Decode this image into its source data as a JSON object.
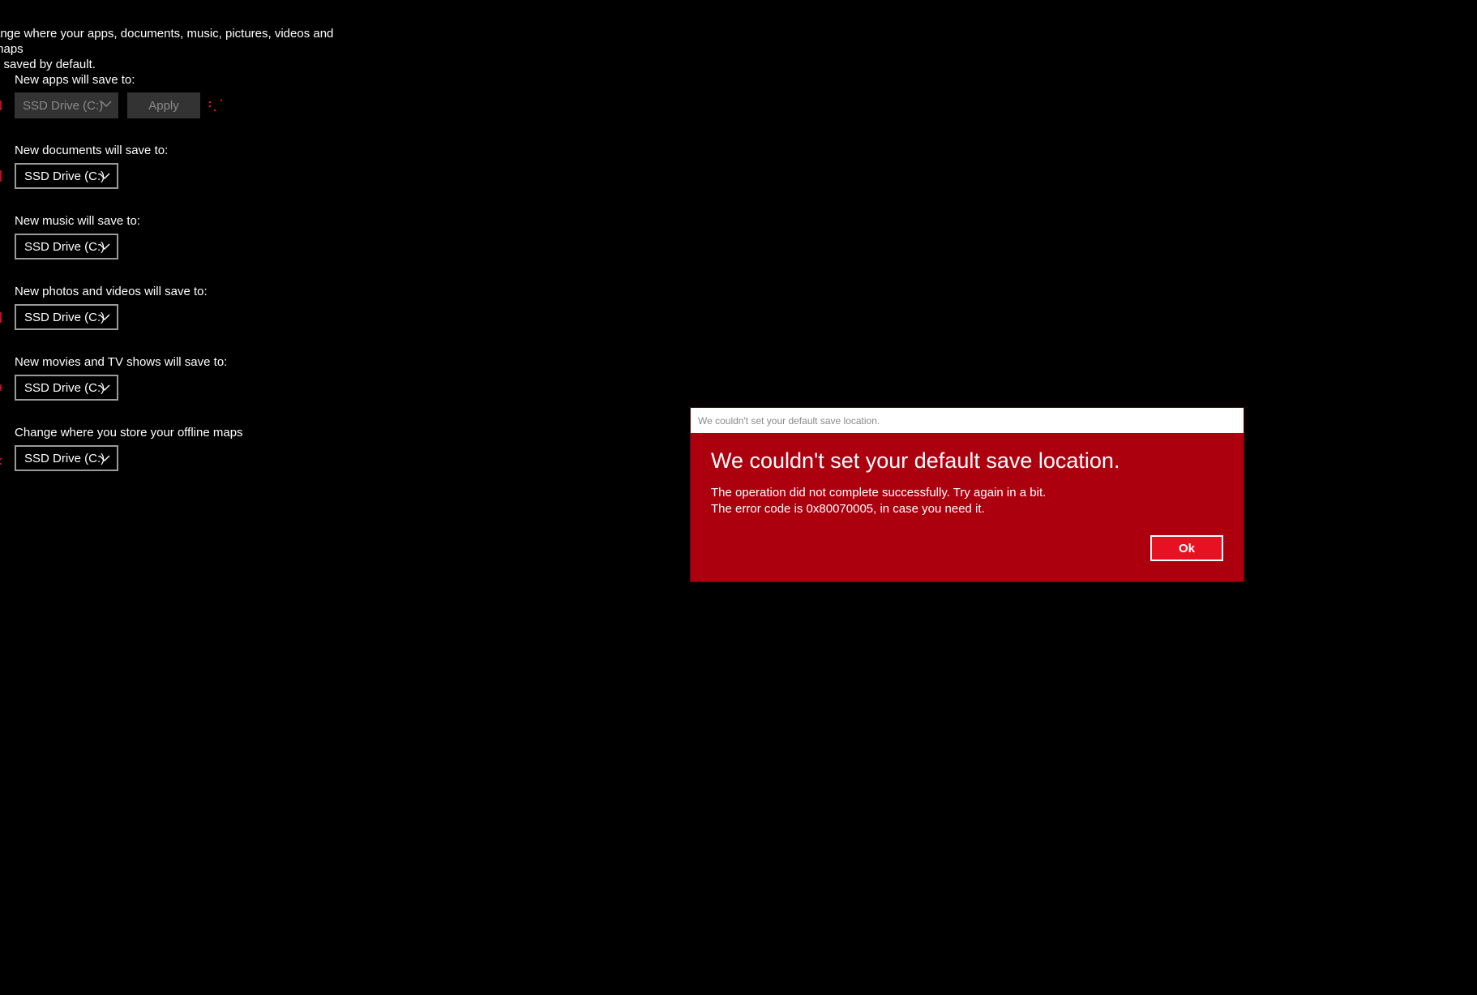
{
  "settings": {
    "intro_line1": "ange where your apps, documents, music, pictures, videos and maps",
    "intro_line2": "e saved by default.",
    "rows": [
      {
        "label": "New apps will save to:",
        "drive": "SSD Drive (C:)",
        "icon": "apps-icon",
        "disabled": true
      },
      {
        "label": "New documents will save to:",
        "drive": "SSD Drive (C:)",
        "icon": "documents-icon"
      },
      {
        "label": "New music will save to:",
        "drive": "SSD Drive (C:)",
        "icon": "music-icon"
      },
      {
        "label": "New photos and videos will save to:",
        "drive": "SSD Drive (C:)",
        "icon": "photos-icon"
      },
      {
        "label": "New movies and TV shows will save to:",
        "drive": "SSD Drive (C:)",
        "icon": "movies-icon"
      },
      {
        "label": "Change where you store your offline maps",
        "drive": "SSD Drive (C:)",
        "icon": "maps-download-icon"
      }
    ],
    "apply_label": "Apply",
    "spinner_icon": "loading-spinner-icon"
  },
  "dialog": {
    "titlebar": "We couldn't set your default save location.",
    "heading": "We couldn't set your default save location.",
    "message_line1": "The operation did not complete successfully. Try again in a bit.",
    "message_line2": "The error code is 0x80070005, in case you need it.",
    "ok_label": "Ok"
  },
  "colors": {
    "background": "#000000",
    "accent": "#e81123",
    "dialog_background": "#ad000f",
    "disabled_control": "#333333"
  }
}
